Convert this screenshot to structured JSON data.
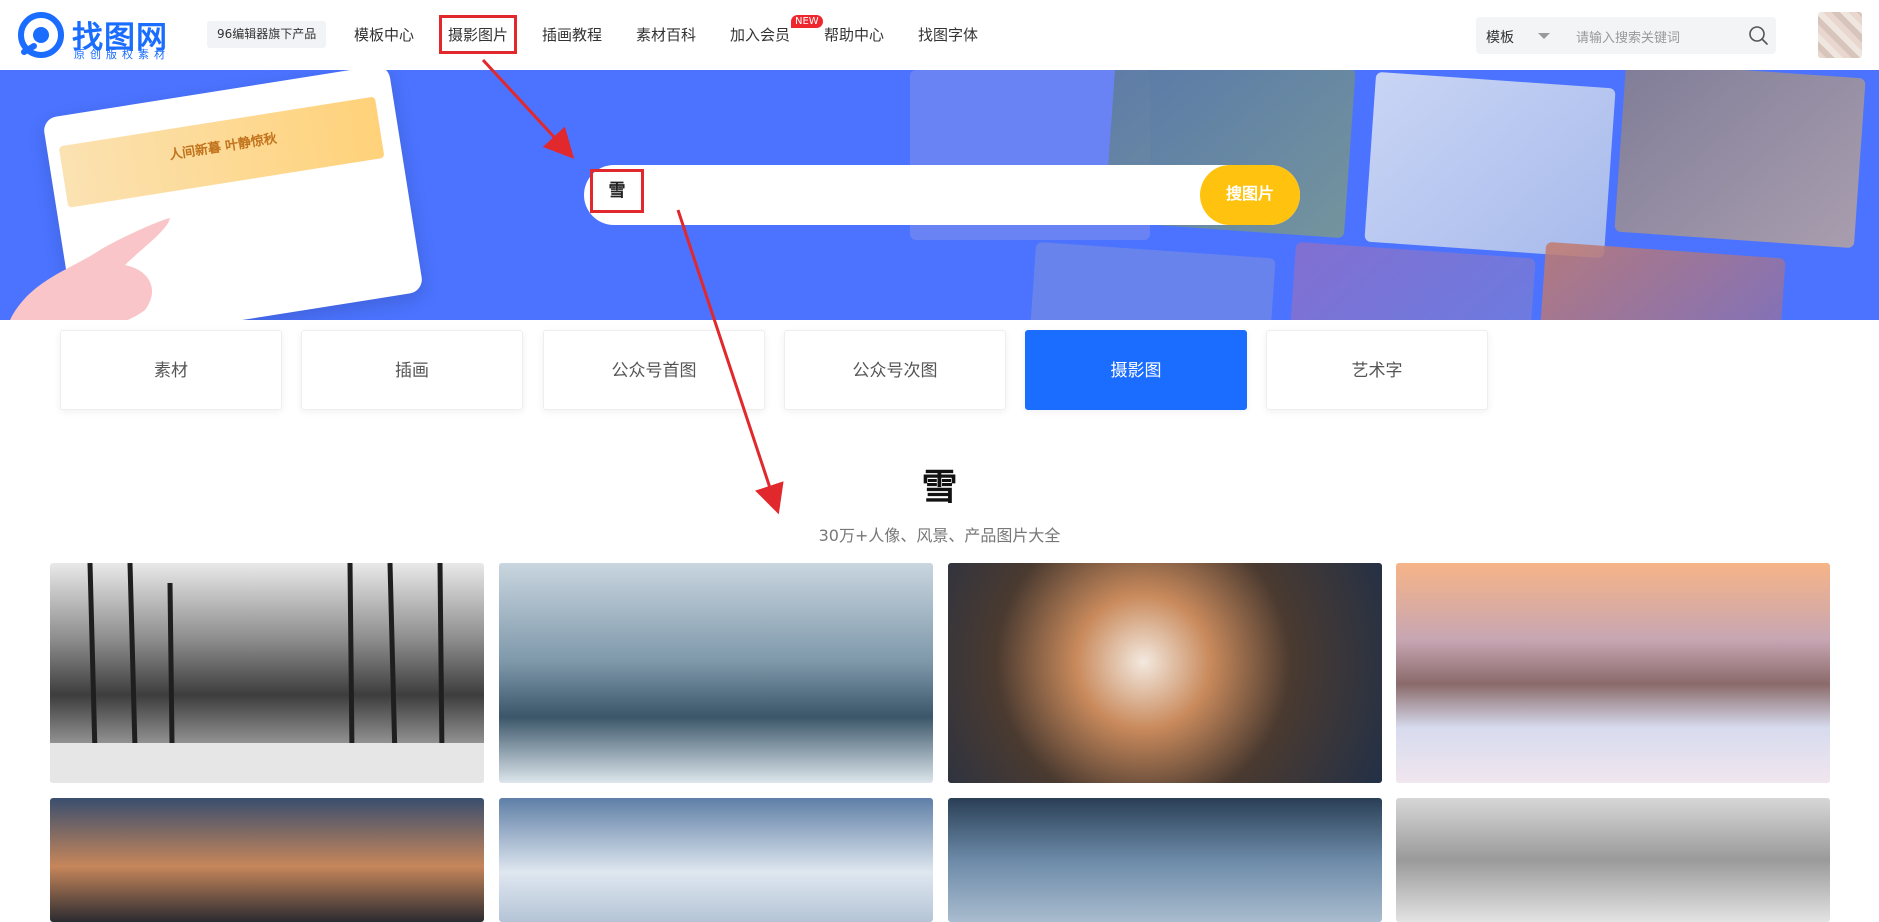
{
  "header": {
    "logo_title": "找图网",
    "logo_sub": "原创版权素材",
    "tag": "96编辑器旗下产品",
    "nav": [
      {
        "label": "模板中心"
      },
      {
        "label": "摄影图片"
      },
      {
        "label": "插画教程"
      },
      {
        "label": "素材百科"
      },
      {
        "label": "加入会员"
      },
      {
        "label": "帮助中心"
      },
      {
        "label": "找图字体"
      }
    ],
    "new_badge": "NEW",
    "search": {
      "type": "模板",
      "placeholder": "请输入搜索关键词"
    }
  },
  "banner": {
    "laptop_text": "人间新暮 叶静惊秋",
    "query": "雪",
    "search_button": "搜图片"
  },
  "categories": [
    {
      "label": "素材"
    },
    {
      "label": "插画"
    },
    {
      "label": "公众号首图"
    },
    {
      "label": "公众号次图"
    },
    {
      "label": "摄影图"
    },
    {
      "label": "艺术字"
    }
  ],
  "active_category": "摄影图",
  "heading": "雪",
  "subheading": "30万+人像、风景、产品图片大全",
  "colors": {
    "brand": "#1a6dff",
    "banner": "#4b73ff",
    "accent_button": "#ffc20e",
    "annotation": "#e0282d"
  }
}
